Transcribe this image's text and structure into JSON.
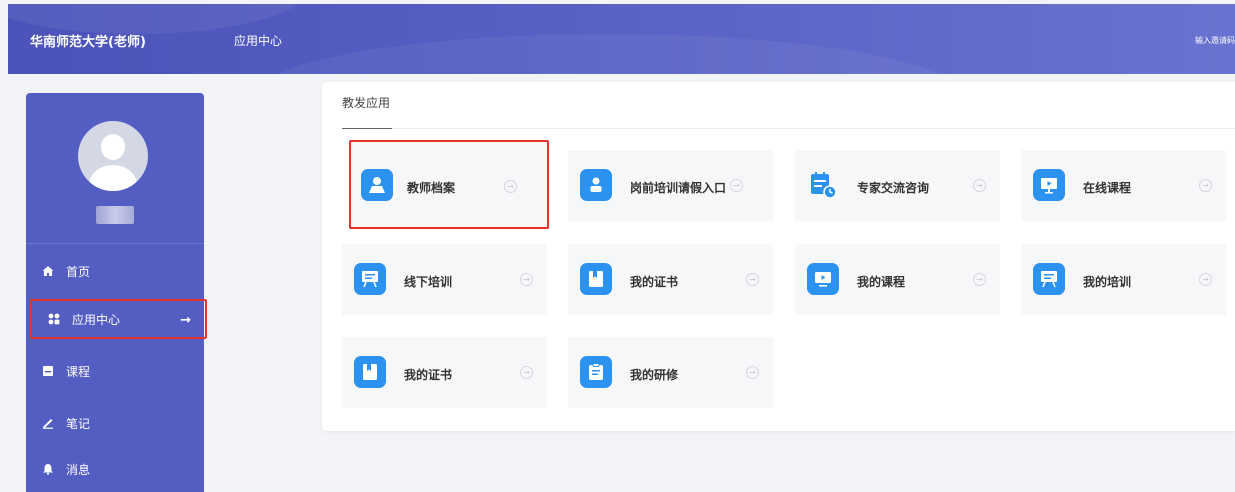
{
  "header": {
    "school_name": "华南师范大学(老师)",
    "nav_item": "应用中心",
    "invite_text": "输入邀请码"
  },
  "sidebar": {
    "items": [
      {
        "label": "首页",
        "icon": "home-icon"
      },
      {
        "label": "应用中心",
        "icon": "apps-icon",
        "active": true
      },
      {
        "label": "课程",
        "icon": "book-icon"
      },
      {
        "label": "笔记",
        "icon": "pencil-icon"
      },
      {
        "label": "消息",
        "icon": "bell-icon"
      }
    ]
  },
  "main": {
    "section_title": "教发应用",
    "apps": [
      {
        "label": "教师档案",
        "icon": "teacher-profile-icon",
        "highlighted": true
      },
      {
        "label": "岗前培训请假入口",
        "icon": "user-leave-icon"
      },
      {
        "label": "专家交流咨询",
        "icon": "calendar-consult-icon"
      },
      {
        "label": "在线课程",
        "icon": "online-course-icon"
      },
      {
        "label": "线下培训",
        "icon": "offline-training-icon"
      },
      {
        "label": "我的证书",
        "icon": "certificate-icon"
      },
      {
        "label": "我的课程",
        "icon": "my-course-icon"
      },
      {
        "label": "我的培训",
        "icon": "my-training-icon"
      },
      {
        "label": "我的证书",
        "icon": "certificate-icon"
      },
      {
        "label": "我的研修",
        "icon": "research-icon"
      }
    ]
  },
  "colors": {
    "header": "#5059bf",
    "sidebar": "#545dc1",
    "tile_icon": "#2b93ef",
    "highlight": "#e6312c"
  }
}
